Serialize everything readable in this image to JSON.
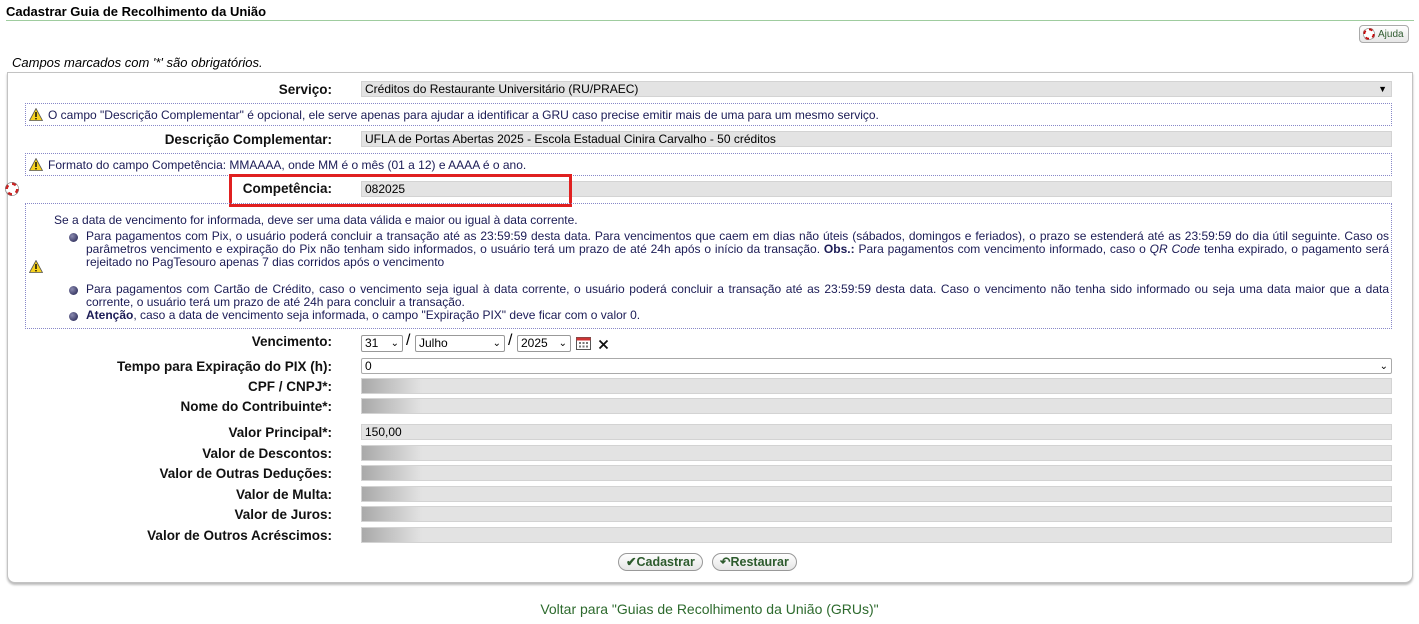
{
  "header": {
    "title": "Cadastrar Guia de Recolhimento da União",
    "help_label": "Ajuda",
    "required_note": "Campos marcados com '*' são obrigatórios."
  },
  "form": {
    "servico": {
      "label": "Serviço:",
      "value": "Créditos do Restaurante Universitário (RU/PRAEC)"
    },
    "note_descricao": "O campo \"Descrição Complementar\" é opcional, ele serve apenas para ajudar a identificar a GRU caso precise emitir mais de uma para um mesmo serviço.",
    "descricao": {
      "label": "Descrição Complementar:",
      "value": "UFLA de Portas Abertas 2025 - Escola Estadual Cinira Carvalho - 50 créditos"
    },
    "note_competencia": "Formato do campo Competência: MMAAAA, onde MM é o mês (01 a 12) e AAAA é o ano.",
    "competencia": {
      "label": "Competência:",
      "value": "082025"
    },
    "vencimento_note": {
      "intro": "Se a data de vencimento for informada, deve ser uma data válida e maior ou igual à data corrente.",
      "pix_a": "Para pagamentos com Pix, o usuário poderá concluir a transação até as 23:59:59 desta data. Para vencimentos que caem em dias não úteis (sábados, domingos e feriados), o prazo se estenderá até as 23:59:59 do dia útil seguinte. Caso os parâmetros vencimento e expiração do Pix não tenham sido informados, o usuário terá um prazo de até 24h após o início da transação. ",
      "pix_obs": "Obs.:",
      "pix_b": " Para pagamentos com vencimento informado, caso o ",
      "pix_qr": "QR Code",
      "pix_c": " tenha expirado, o pagamento será rejeitado no PagTesouro apenas 7 dias corridos após o vencimento",
      "cartao": "Para pagamentos com Cartão de Crédito, caso o vencimento seja igual à data corrente, o usuário poderá concluir a transação até as 23:59:59 desta data. Caso o vencimento não tenha sido informado ou seja uma data maior que a data corrente, o usuário terá um prazo de até 24h para concluir a transação.",
      "atencao_bold": "Atenção",
      "atencao_rest": ", caso a data de vencimento seja informada, o campo \"Expiração PIX\" deve ficar com o valor 0."
    },
    "vencimento": {
      "label": "Vencimento:",
      "day": "31",
      "month": "Julho",
      "year": "2025",
      "sep": "/"
    },
    "expiracao_pix": {
      "label": "Tempo para Expiração do PIX (h):",
      "value": "0"
    },
    "cpf": {
      "label": "CPF / CNPJ*:",
      "value": ""
    },
    "nome": {
      "label": "Nome do Contribuinte*:",
      "value": ""
    },
    "valor_principal": {
      "label": "Valor Principal*:",
      "value": "150,00"
    },
    "descontos": {
      "label": "Valor de Descontos:",
      "value": ""
    },
    "outras_deducoes": {
      "label": "Valor de Outras Deduções:",
      "value": ""
    },
    "multa": {
      "label": "Valor de Multa:",
      "value": ""
    },
    "juros": {
      "label": "Valor de Juros:",
      "value": ""
    },
    "outros_acrescimos": {
      "label": "Valor de Outros Acréscimos:",
      "value": ""
    }
  },
  "actions": {
    "cadastrar": "Cadastrar",
    "restaurar": "Restaurar"
  },
  "footer": {
    "back_link": "Voltar para \"Guias de Recolhimento da União (GRUs)\""
  },
  "colors": {
    "accent_green": "#2d6a2d",
    "highlight_red": "#e02020",
    "note_text": "#1b1b55"
  }
}
